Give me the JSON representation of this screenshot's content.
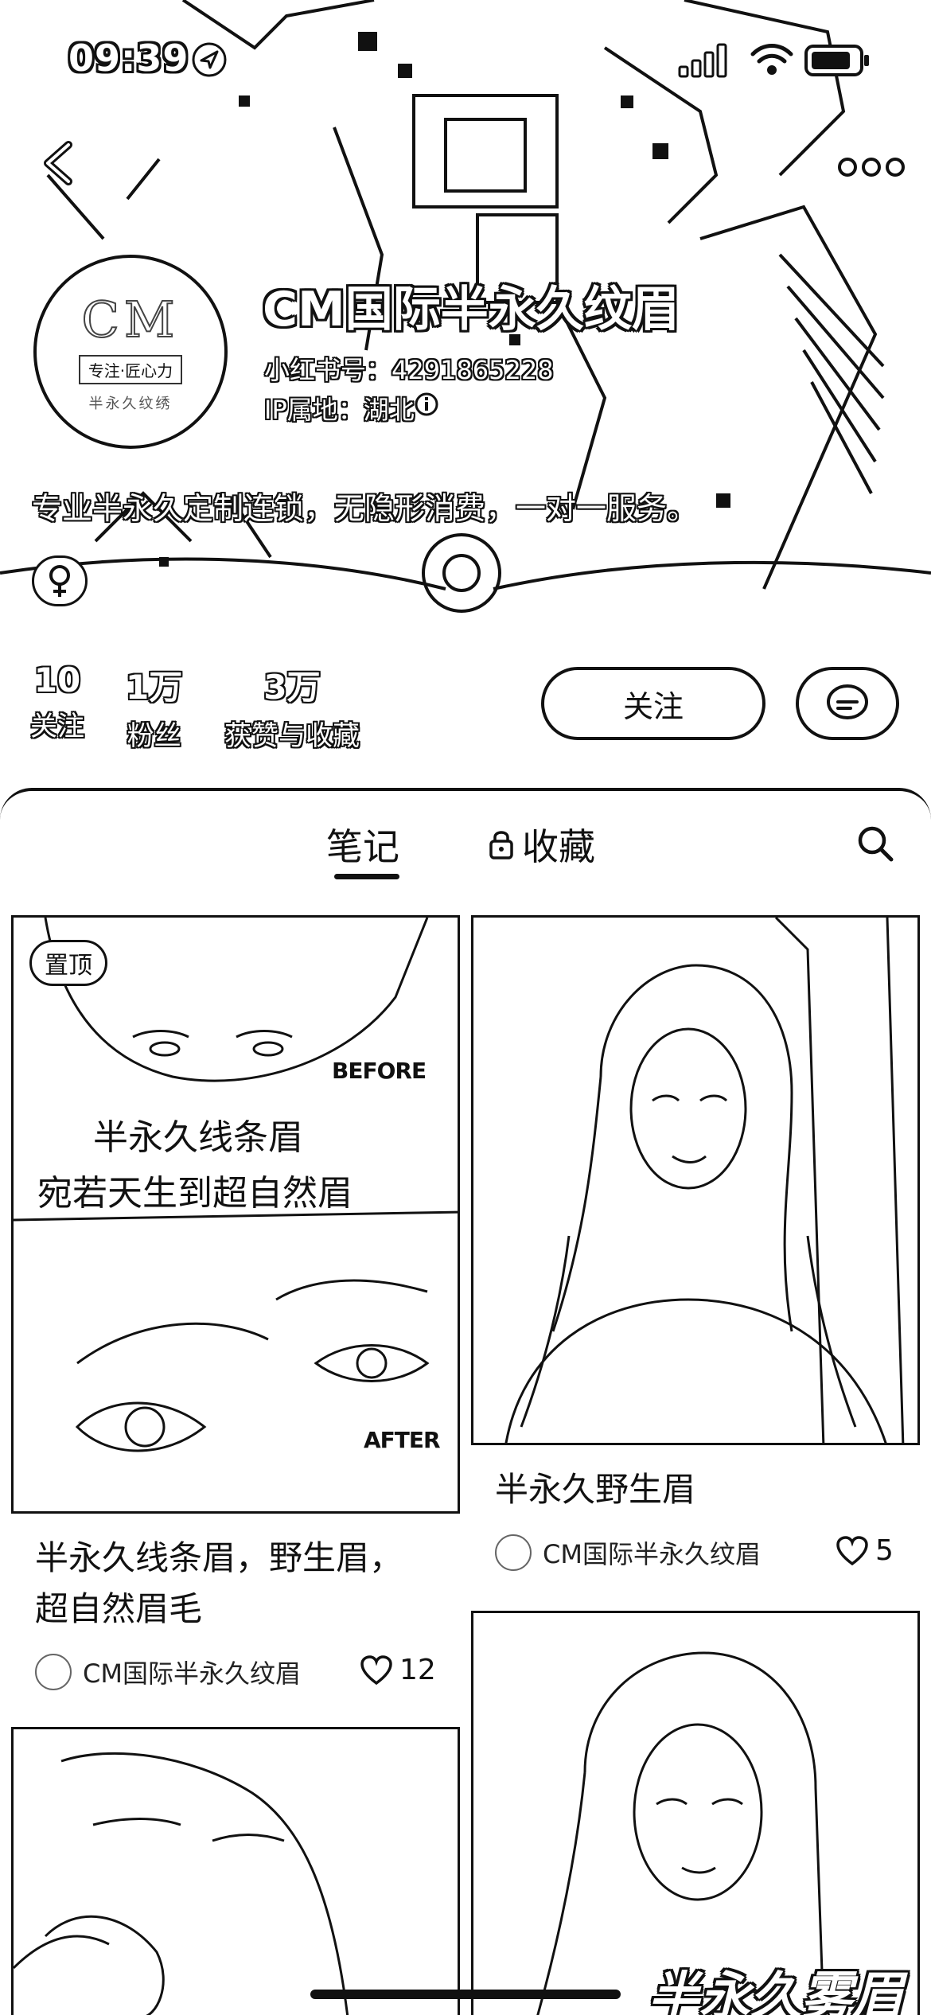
{
  "status_bar": {
    "time": "09:39",
    "icons": [
      "location-arrow-icon",
      "signal-icon",
      "wifi-icon",
      "battery-icon"
    ]
  },
  "header": {
    "back_icon": "chevron-left-icon",
    "more_icon": "more-dots-icon",
    "avatar": {
      "logo_text": "CM",
      "sub_text": "专注·匠心力",
      "sub_text2": "半永久纹绣"
    },
    "nickname": "CM国际半永久纹眉",
    "red_id": "小红书号：4291865228",
    "ip_location": "IP属地：湖北",
    "bio": "专业半永久定制连锁，无隐形消费，一对一服务。",
    "gender_icon": "female-icon"
  },
  "stats": [
    {
      "value": "10",
      "label": "关注"
    },
    {
      "value": "1万",
      "label": "粉丝"
    },
    {
      "value": "3万",
      "label": "获赞与收藏"
    }
  ],
  "actions": {
    "follow_label": "关注",
    "chat_icon": "chat-bubble-icon"
  },
  "tabs": [
    {
      "label": "笔记",
      "active": true
    },
    {
      "label": "收藏",
      "locked": true
    }
  ],
  "notes": [
    {
      "pinned_label": "置顶",
      "overlay_before": "BEFORE",
      "overlay_title_1": "半永久线条眉",
      "overlay_title_2": "宛若天生到超自然眉",
      "overlay_after": "AFTER",
      "title": "半永久线条眉，野生眉，超自然眉毛",
      "author": "CM国际半永久纹眉",
      "likes": "12"
    },
    {
      "title": "半永久野生眉",
      "author": "CM国际半永久纹眉",
      "likes": "5"
    },
    {
      "title": "",
      "author": "",
      "likes": ""
    },
    {
      "overlay_text": "半永久雾眉"
    }
  ]
}
